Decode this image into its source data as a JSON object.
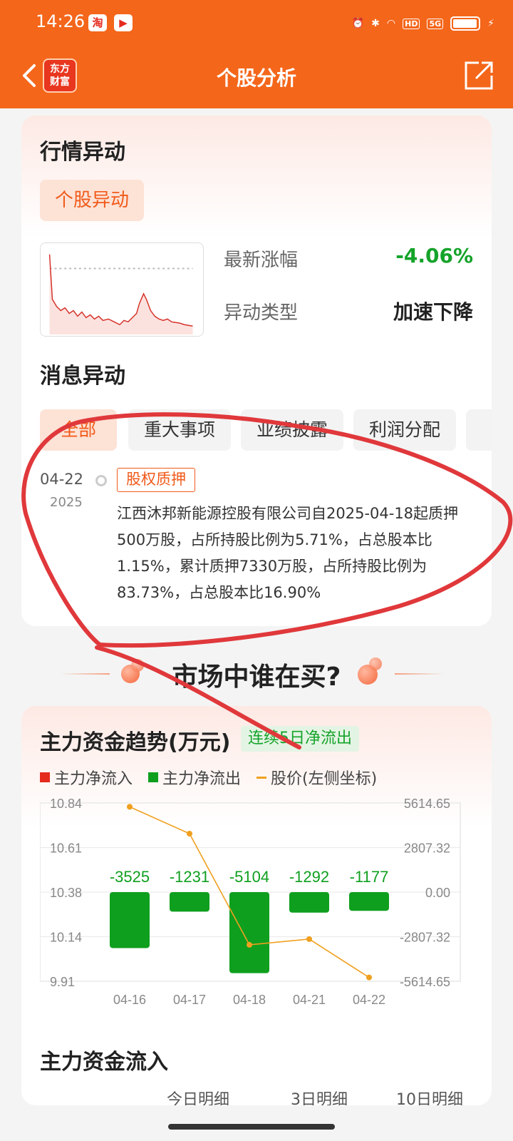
{
  "status": {
    "time": "14:26",
    "icons": [
      "taobao-icon",
      "video-app-icon",
      "alarm-icon",
      "bluetooth-icon",
      "wifi-icon",
      "hd-badge",
      "signal-5g-icon",
      "battery-icon",
      "charging-icon"
    ],
    "hd": "HD",
    "net": "5G"
  },
  "nav": {
    "title": "个股分析",
    "logo_line1": "东方",
    "logo_line2": "财富"
  },
  "market": {
    "title": "行情异动",
    "tag": "个股异动",
    "latest_change_label": "最新涨幅",
    "latest_change_value": "-4.06%",
    "type_label": "异动类型",
    "type_value": "加速下降"
  },
  "news": {
    "title": "消息异动",
    "tabs": [
      "全部",
      "重大事项",
      "业绩披露",
      "利润分配"
    ],
    "item": {
      "date": "04-22",
      "year": "2025",
      "tag": "股权质押",
      "body": "江西沐邦新能源控股有限公司自2025-04-18起质押500万股，占所持股比例为5.71%，占总股本比1.15%，累计质押7330万股，占所持股比例为83.73%，占总股本比16.90%"
    }
  },
  "buyers": {
    "title": "市场中谁在买?"
  },
  "capital": {
    "title": "主力资金趋势(万元)",
    "chip": "连续5日净流出",
    "legend": [
      "主力净流入",
      "主力净流出",
      "股价(左侧坐标)"
    ],
    "flow_title": "主力资金流入",
    "subtabs": [
      "今日明细",
      "3日明细",
      "10日明细"
    ]
  },
  "colors": {
    "brand": "#f4661a",
    "inflow": "#e52b1e",
    "outflow": "#0f9f1e",
    "price_line": "#f0a020",
    "annotation": "#e0383b"
  },
  "chart_data": {
    "type": "bar",
    "categories": [
      "04-16",
      "04-17",
      "04-18",
      "04-21",
      "04-22"
    ],
    "series": [
      {
        "name": "主力净流出",
        "values": [
          -3525,
          -1231,
          -5104,
          -1292,
          -1177
        ]
      },
      {
        "name": "股价(左侧坐标)",
        "type": "line",
        "values": [
          10.82,
          10.68,
          10.1,
          10.13,
          9.93
        ]
      }
    ],
    "left_axis": {
      "ticks": [
        "10.84",
        "10.61",
        "10.38",
        "10.14",
        "9.91"
      ],
      "range": [
        9.91,
        10.84
      ]
    },
    "right_axis": {
      "ticks": [
        "5614.65",
        "2807.32",
        "0.00",
        "-2807.32",
        "-5614.65"
      ],
      "range": [
        -5614.65,
        5614.65
      ]
    },
    "data_labels": [
      "-3525",
      "-1231",
      "-5104",
      "-1292",
      "-1177"
    ],
    "grid": true
  }
}
